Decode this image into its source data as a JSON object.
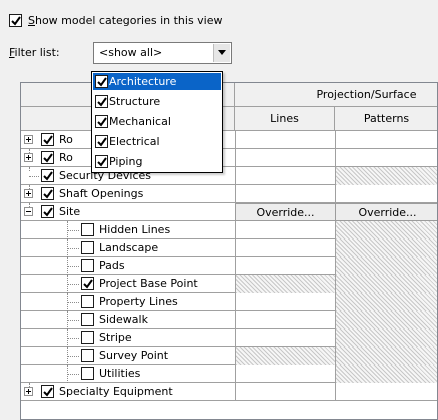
{
  "show_categories": {
    "label_first": "S",
    "label_rest": "how model categories in this view",
    "checked": true
  },
  "filter": {
    "label_first": "F",
    "label_rest": "ilter list:",
    "value": "<show all>"
  },
  "headers": {
    "projection_surface": "Projection/Surface",
    "lines": "Lines",
    "patterns": "Patterns"
  },
  "filter_options": [
    {
      "label": "Architecture",
      "checked": true,
      "highlighted": true
    },
    {
      "label": "Structure",
      "checked": true,
      "highlighted": false
    },
    {
      "label": "Mechanical",
      "checked": true,
      "highlighted": false
    },
    {
      "label": "Electrical",
      "checked": true,
      "highlighted": false
    },
    {
      "label": "Piping",
      "checked": true,
      "highlighted": false
    }
  ],
  "rows": [
    {
      "label": "Ro",
      "checked": true,
      "expander": "plus",
      "lines": "",
      "patterns": ""
    },
    {
      "label": "Ro",
      "checked": true,
      "expander": "plus",
      "lines": "",
      "patterns": ""
    },
    {
      "label": "Security Devices",
      "checked": true,
      "expander": "none",
      "lines": "",
      "patterns": "hatch"
    },
    {
      "label": "Shaft Openings",
      "checked": true,
      "expander": "plus",
      "lines": "",
      "patterns": ""
    },
    {
      "label": "Site",
      "checked": true,
      "expander": "minus",
      "lines": "Override...",
      "patterns": "Override..."
    },
    {
      "label": "Hidden Lines",
      "checked": false,
      "expander": "child",
      "lines": "",
      "patterns": "hatch"
    },
    {
      "label": "Landscape",
      "checked": false,
      "expander": "child",
      "lines": "",
      "patterns": "hatch"
    },
    {
      "label": "Pads",
      "checked": false,
      "expander": "child",
      "lines": "",
      "patterns": "hatch"
    },
    {
      "label": "Project Base Point",
      "checked": true,
      "expander": "child",
      "lines": "hatch",
      "patterns": "hatch"
    },
    {
      "label": "Property Lines",
      "checked": false,
      "expander": "child",
      "lines": "",
      "patterns": "hatch"
    },
    {
      "label": "Sidewalk",
      "checked": false,
      "expander": "child",
      "lines": "",
      "patterns": "hatch"
    },
    {
      "label": "Stripe",
      "checked": false,
      "expander": "child",
      "lines": "",
      "patterns": "hatch"
    },
    {
      "label": "Survey Point",
      "checked": false,
      "expander": "child",
      "lines": "hatch",
      "patterns": "hatch"
    },
    {
      "label": "Utilities",
      "checked": false,
      "expander": "child",
      "lines": "",
      "patterns": "hatch"
    },
    {
      "label": "Specialty Equipment",
      "checked": true,
      "expander": "plus",
      "lines": "",
      "patterns": ""
    }
  ],
  "colors": {
    "selection": "#0a64c8",
    "grid_line": "#a0a0a0",
    "background": "#f0f0f0"
  },
  "icons": [
    "checkbox-check-icon",
    "dropdown-arrow-icon",
    "expand-plus-icon",
    "collapse-minus-icon"
  ]
}
